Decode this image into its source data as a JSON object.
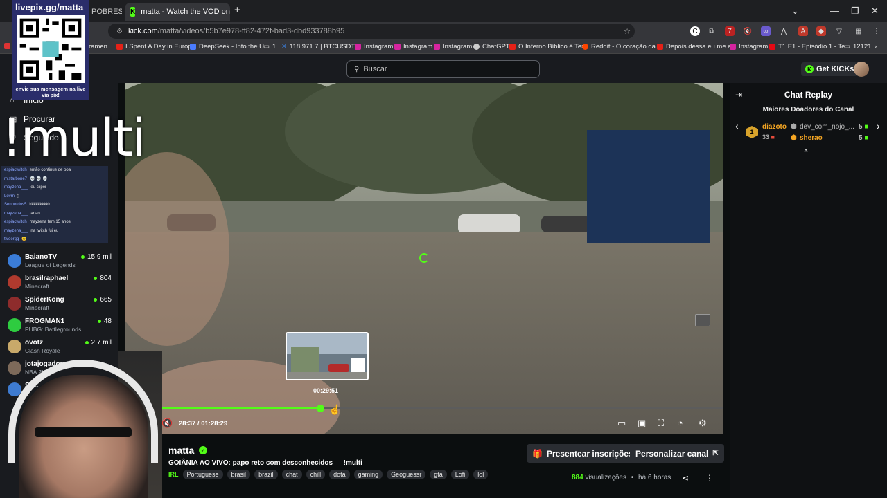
{
  "browser": {
    "tabs": [
      {
        "title": "POBRES",
        "active": false
      },
      {
        "title": "matta - Watch the VOD on Kick",
        "active": true
      }
    ],
    "new_tab": "+",
    "url_host": "kick.com",
    "url_path": "/matta/videos/b5b7e978-ff82-472f-bad3-dbd933788b95",
    "bookmarks": [
      "ramen...",
      "I Spent A Day in Europ...",
      "DeepSeek - Into the U...",
      "1",
      "118,971.7 | BTCUSDT P...",
      "Instagram",
      "Instagram",
      "Instagram",
      "ChatGPT",
      "O Inferno Bíblico é Ter...",
      "Reddit - O coração da ...",
      "Depois dessa eu me a...",
      "Instagram",
      "T1:E1 - Episódio 1 - Te...",
      "12121"
    ]
  },
  "header": {
    "search_placeholder": "Buscar",
    "get_kicks": "Get KICKs"
  },
  "overlay": {
    "qr_title": "livepix.gg/matta",
    "qr_caption": "envie sua mensagem na live via pix!",
    "multi_text": "!multi"
  },
  "sidebar": {
    "nav": [
      "Início",
      "Procurar",
      "Seguindo"
    ],
    "mini_chat": [
      {
        "user": "espiactwitch",
        "msg": "então continue de boa"
      },
      {
        "user": "mistarbone7",
        "msg": "💀 💀 💀"
      },
      {
        "user": "mayzena___",
        "msg": "eu clipei"
      },
      {
        "user": "Lovrn",
        "msg": "🕯"
      },
      {
        "user": "Senhordos5",
        "msg": "kkkkkkkkkk"
      },
      {
        "user": "mayzena___",
        "msg": "anao"
      },
      {
        "user": "espiactwitch",
        "msg": "mayzena tem 15 anos"
      },
      {
        "user": "mayzena___",
        "msg": "na twitch fui eu"
      },
      {
        "user": "tweergg",
        "msg": "😊"
      }
    ],
    "channels": [
      {
        "name": "BaianoTV",
        "game": "League of Legends",
        "viewers": "15,9 mil",
        "color": "#3b7dd8"
      },
      {
        "name": "brasilraphael",
        "game": "Minecraft",
        "viewers": "804",
        "color": "#b03a2e"
      },
      {
        "name": "SpiderKong",
        "game": "Minecraft",
        "viewers": "665",
        "color": "#8e2c2c"
      },
      {
        "name": "FROGMAN1",
        "game": "PUBG: Battlegrounds",
        "viewers": "48",
        "color": "#2ecc40"
      },
      {
        "name": "ovotz",
        "game": "Clash Royale",
        "viewers": "2,7 mil",
        "color": "#c8a96a"
      },
      {
        "name": "jotajogador",
        "game": "NBA 2K",
        "viewers": "",
        "color": "#7d6a5a"
      },
      {
        "name": "Sy...",
        "game": "",
        "viewers": "",
        "color": "#3e7bd0"
      }
    ]
  },
  "video": {
    "preview_time": "00:29:51",
    "current_time": "28:37 / 01:28:29",
    "progress": 0.29,
    "hover": 0.31
  },
  "channel": {
    "name": "matta",
    "title": "GOIÂNIA AO VIVO: papo reto com desconhecidos — !multi",
    "category": "IRL",
    "tags": [
      "Portuguese",
      "brasil",
      "brazil",
      "chat",
      "chill",
      "dota",
      "gaming",
      "Geoguessr",
      "gta",
      "Lofi",
      "lol"
    ],
    "gift_button": "Presentear inscrições",
    "customize_button": "Personalizar canal",
    "views_count": "884",
    "views_label": "visualizações",
    "age": "há 6 horas"
  },
  "chat": {
    "title": "Chat Replay",
    "subtitle": "Maiores Doadores do Canal",
    "rank": "1",
    "donor1": "diazoto",
    "donor1_amount": "33",
    "donor2": "dev_com_nojo_...",
    "donor2_amount": "5",
    "donor3": "sherao",
    "donor3_amount": "5"
  },
  "colors": {
    "accent": "#53fc18",
    "bg": "#0b0e0f",
    "panel": "#191b1f"
  }
}
